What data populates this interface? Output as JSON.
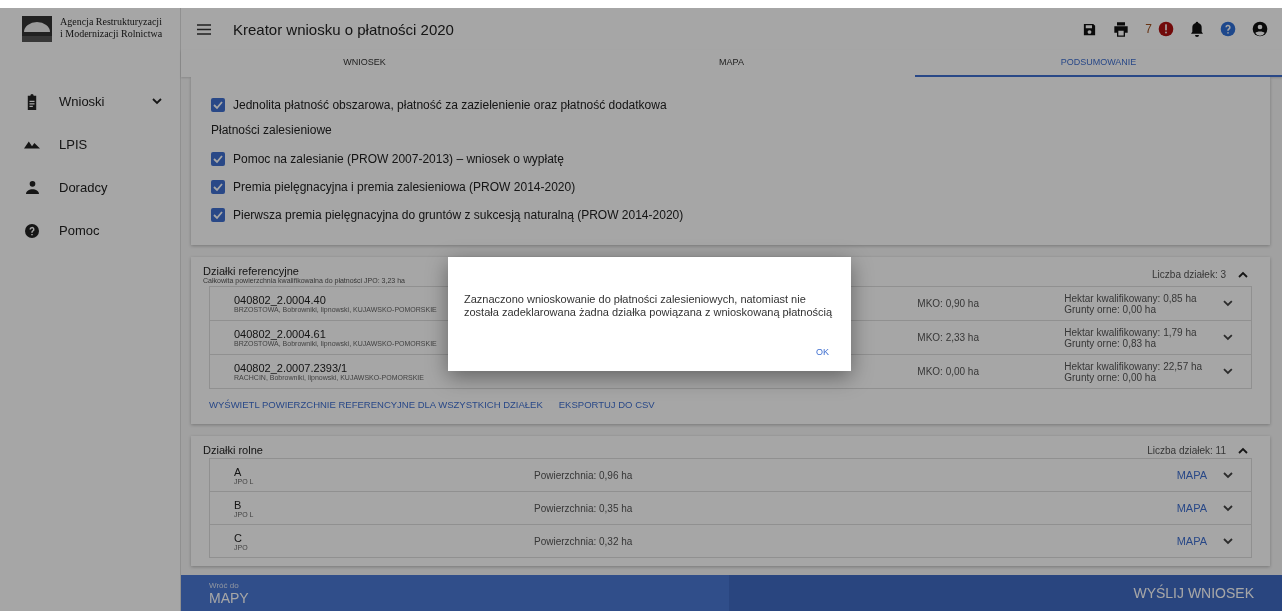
{
  "logo": {
    "line_1": "Agencja Restrukturyzacji",
    "line_2": "i Modernizacji Rolnictwa"
  },
  "header": {
    "title": "Kreator wniosku o płatności 2020",
    "alert_count": "7"
  },
  "tabs": [
    {
      "label": "WNIOSEK",
      "selected": false
    },
    {
      "label": "MAPA",
      "selected": false
    },
    {
      "label": "PODSUMOWANIE",
      "selected": true
    }
  ],
  "sidebar": {
    "items": [
      {
        "label": "Wnioski",
        "expandable": true
      },
      {
        "label": "LPIS",
        "expandable": false
      },
      {
        "label": "Doradcy",
        "expandable": false
      },
      {
        "label": "Pomoc",
        "expandable": false
      }
    ]
  },
  "payments": {
    "groups": [
      {
        "items": [
          {
            "label": "Jednolita płatność obszarowa, płatność za zazielenienie oraz płatność dodatkowa",
            "checked": true
          }
        ]
      },
      {
        "heading": "Płatności zalesieniowe",
        "items": [
          {
            "label": "Pomoc na zalesianie (PROW 2007-2013) – wniosek o wypłatę",
            "checked": true
          },
          {
            "label": "Premia pielęgnacyjna i premia zalesieniowa (PROW 2014-2020)",
            "checked": true
          },
          {
            "label": "Pierwsza premia pielęgnacyjna do gruntów z sukcesją naturalną (PROW 2014-2020)",
            "checked": true
          }
        ]
      }
    ]
  },
  "reference_parcels": {
    "title": "Działki referencyjne",
    "subtitle": "Całkowita powierzchnia kwalifikowalna do płatności JPO: 3,23 ha",
    "count": "Liczba działek: 3",
    "expanded": true,
    "rows": [
      {
        "id": "040802_2.0004.40",
        "address": "BRZOSTOWA, Bobrowniki, lipnowski, KUJAWSKO-POMORSKIE",
        "mko": "MKO: 0,90 ha",
        "hectare": "Hektar kwalifikowany: 0,85 ha",
        "arable": "Grunty orne: 0,00 ha"
      },
      {
        "id": "040802_2.0004.61",
        "address": "BRZOSTOWA, Bobrowniki, lipnowski, KUJAWSKO-POMORSKIE",
        "mko": "MKO: 2,33 ha",
        "hectare": "Hektar kwalifikowany: 1,79 ha",
        "arable": "Grunty orne: 0,83 ha"
      },
      {
        "id": "040802_2.0007.2393/1",
        "address": "RACHCIN, Bobrowniki, lipnowski, KUJAWSKO-POMORSKIE",
        "mko": "MKO: 0,00 ha",
        "hectare": "Hektar kwalifikowany: 22,57 ha",
        "arable": "Grunty orne: 0,00 ha"
      }
    ],
    "links": [
      "WYŚWIETL POWIERZCHNIE REFERENCYJNE DLA WSZYSTKICH DZIAŁEK",
      "EKSPORTUJ DO CSV"
    ]
  },
  "agricultural_parcels": {
    "title": "Działki rolne",
    "count": "Liczba działek: 11",
    "expanded": true,
    "rows": [
      {
        "name": "A",
        "code": "JPO L",
        "area": "Powierzchnia: 0,96 ha",
        "map": "MAPA"
      },
      {
        "name": "B",
        "code": "JPO L",
        "area": "Powierzchnia: 0,35 ha",
        "map": "MAPA"
      },
      {
        "name": "C",
        "code": "JPO",
        "area": "Powierzchnia: 0,32 ha",
        "map": "MAPA"
      }
    ]
  },
  "footer": {
    "back_label": "Wróć do",
    "back_target": "MAPY",
    "submit": "WYŚLIJ WNIOSEK"
  },
  "dialog": {
    "message": "Zaznaczono wnioskowanie do płatności zalesieniowych, natomiast nie została zadeklarowana żadna działka powiązana z wnioskowaną płatnością",
    "button": "OK"
  }
}
